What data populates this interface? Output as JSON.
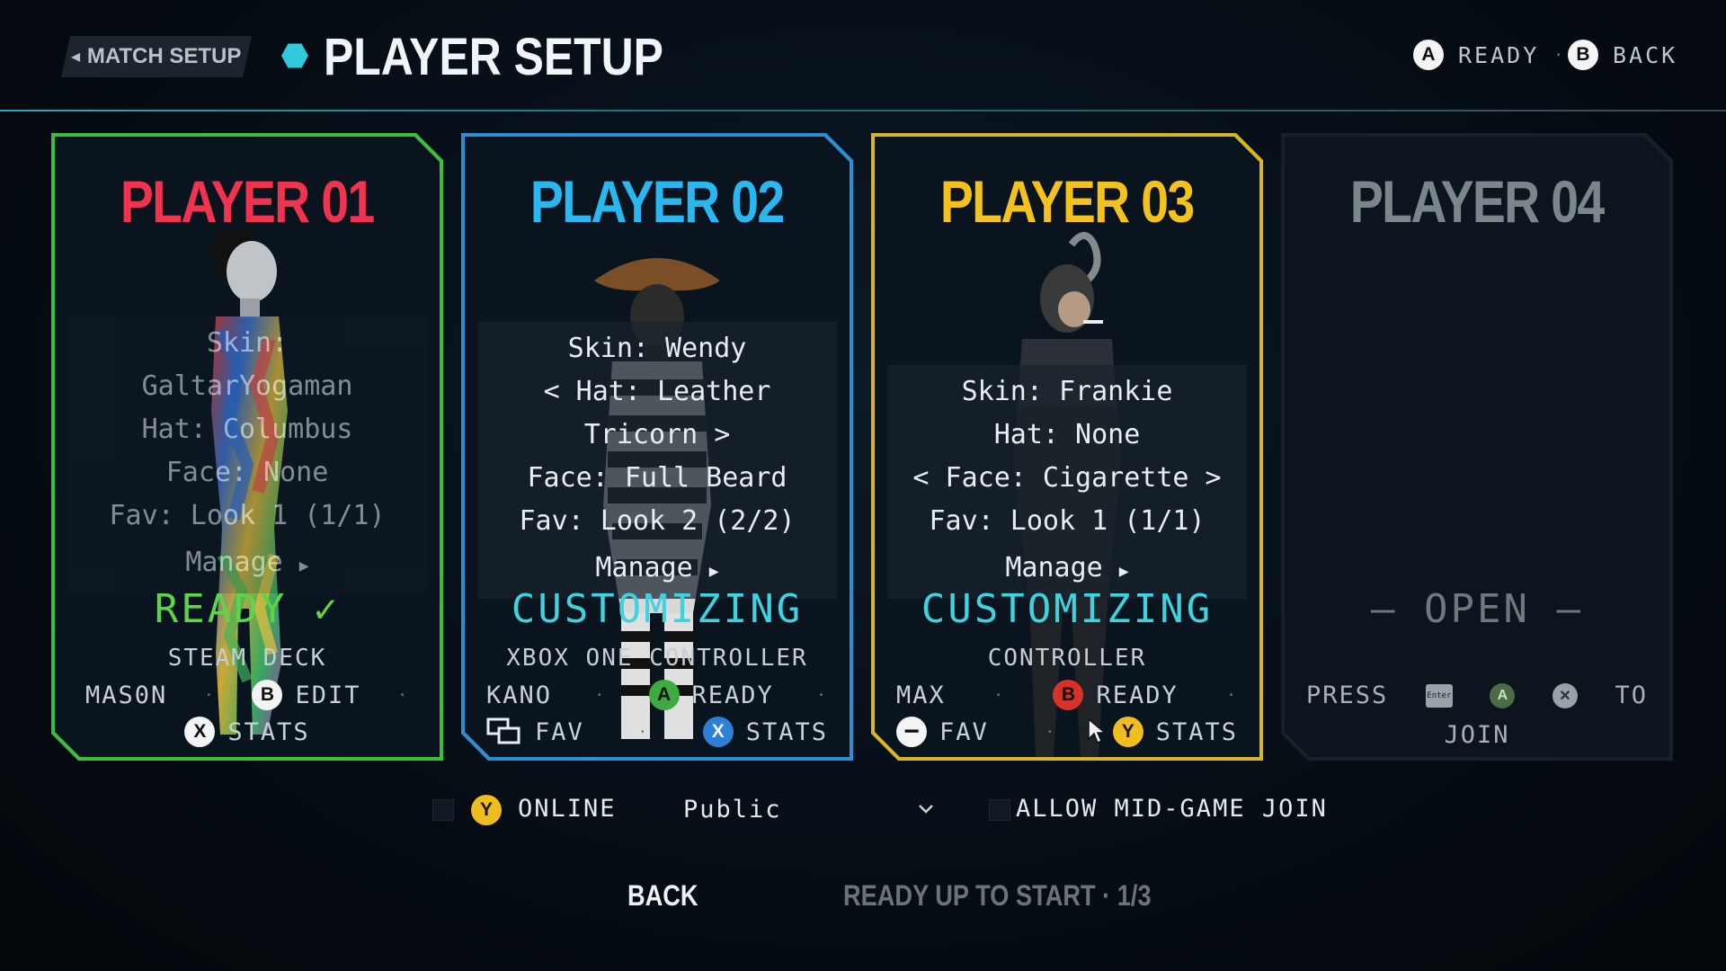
{
  "header": {
    "back_tab": "MATCH SETUP",
    "title": "PLAYER SETUP",
    "hints": [
      {
        "glyph": "A",
        "label": "READY"
      },
      {
        "glyph": "B",
        "label": "BACK"
      }
    ]
  },
  "players": [
    {
      "title": "PLAYER 01",
      "title_color": "#f0334f",
      "skin_label": "Skin:",
      "skin_value": "GaltarYogaman",
      "hat": "Hat: Columbus",
      "face": "Face: None",
      "fav": "Fav: Look 1 (1/1)",
      "manage": "Manage",
      "status": "READY ✓",
      "status_color": "#5fd44a",
      "device": "STEAM DECK",
      "name": "MAS0N",
      "actions": [
        {
          "glyph": "B",
          "label": "EDIT"
        },
        {
          "glyph": "X",
          "label": "STATS"
        }
      ]
    },
    {
      "title": "PLAYER 02",
      "title_color": "#2ab6ee",
      "skin": "Skin: Wendy",
      "hat_line1": "< Hat: Leather",
      "hat_line2": "Tricorn >",
      "face": "Face: Full Beard",
      "fav": "Fav: Look 2 (2/2)",
      "manage": "Manage",
      "status": "CUSTOMIZING",
      "status_color": "#3fd2df",
      "device": "XBOX ONE CONTROLLER",
      "name": "KANO",
      "actions": [
        {
          "glyph": "A",
          "label": "READY"
        },
        {
          "glyph": "view",
          "label": "FAV"
        },
        {
          "glyph": "X",
          "label": "STATS"
        }
      ]
    },
    {
      "title": "PLAYER 03",
      "title_color": "#f3c21f",
      "skin": "Skin: Frankie",
      "hat": "Hat: None",
      "face": "< Face: Cigarette >",
      "fav": "Fav: Look 1 (1/1)",
      "manage": "Manage",
      "status": "CUSTOMIZING",
      "status_color": "#3fd2df",
      "device": "CONTROLLER",
      "name": "MAX",
      "actions": [
        {
          "glyph": "B",
          "label": "READY"
        },
        {
          "glyph": "minus",
          "label": "FAV"
        },
        {
          "glyph": "Y",
          "label": "STATS"
        }
      ]
    },
    {
      "title": "PLAYER 04",
      "title_color": "#7b858c",
      "status": "— OPEN —",
      "press": "PRESS",
      "to": "TO",
      "join": "JOIN",
      "key_label": "Enter",
      "glyph_a": "A",
      "glyph_x": "✕"
    }
  ],
  "bottom": {
    "online_glyph": "Y",
    "online_label": "ONLINE",
    "visibility": "Public",
    "allow_join": "ALLOW MID-GAME JOIN",
    "back": "BACK",
    "status": "READY UP TO START · 1/3"
  }
}
